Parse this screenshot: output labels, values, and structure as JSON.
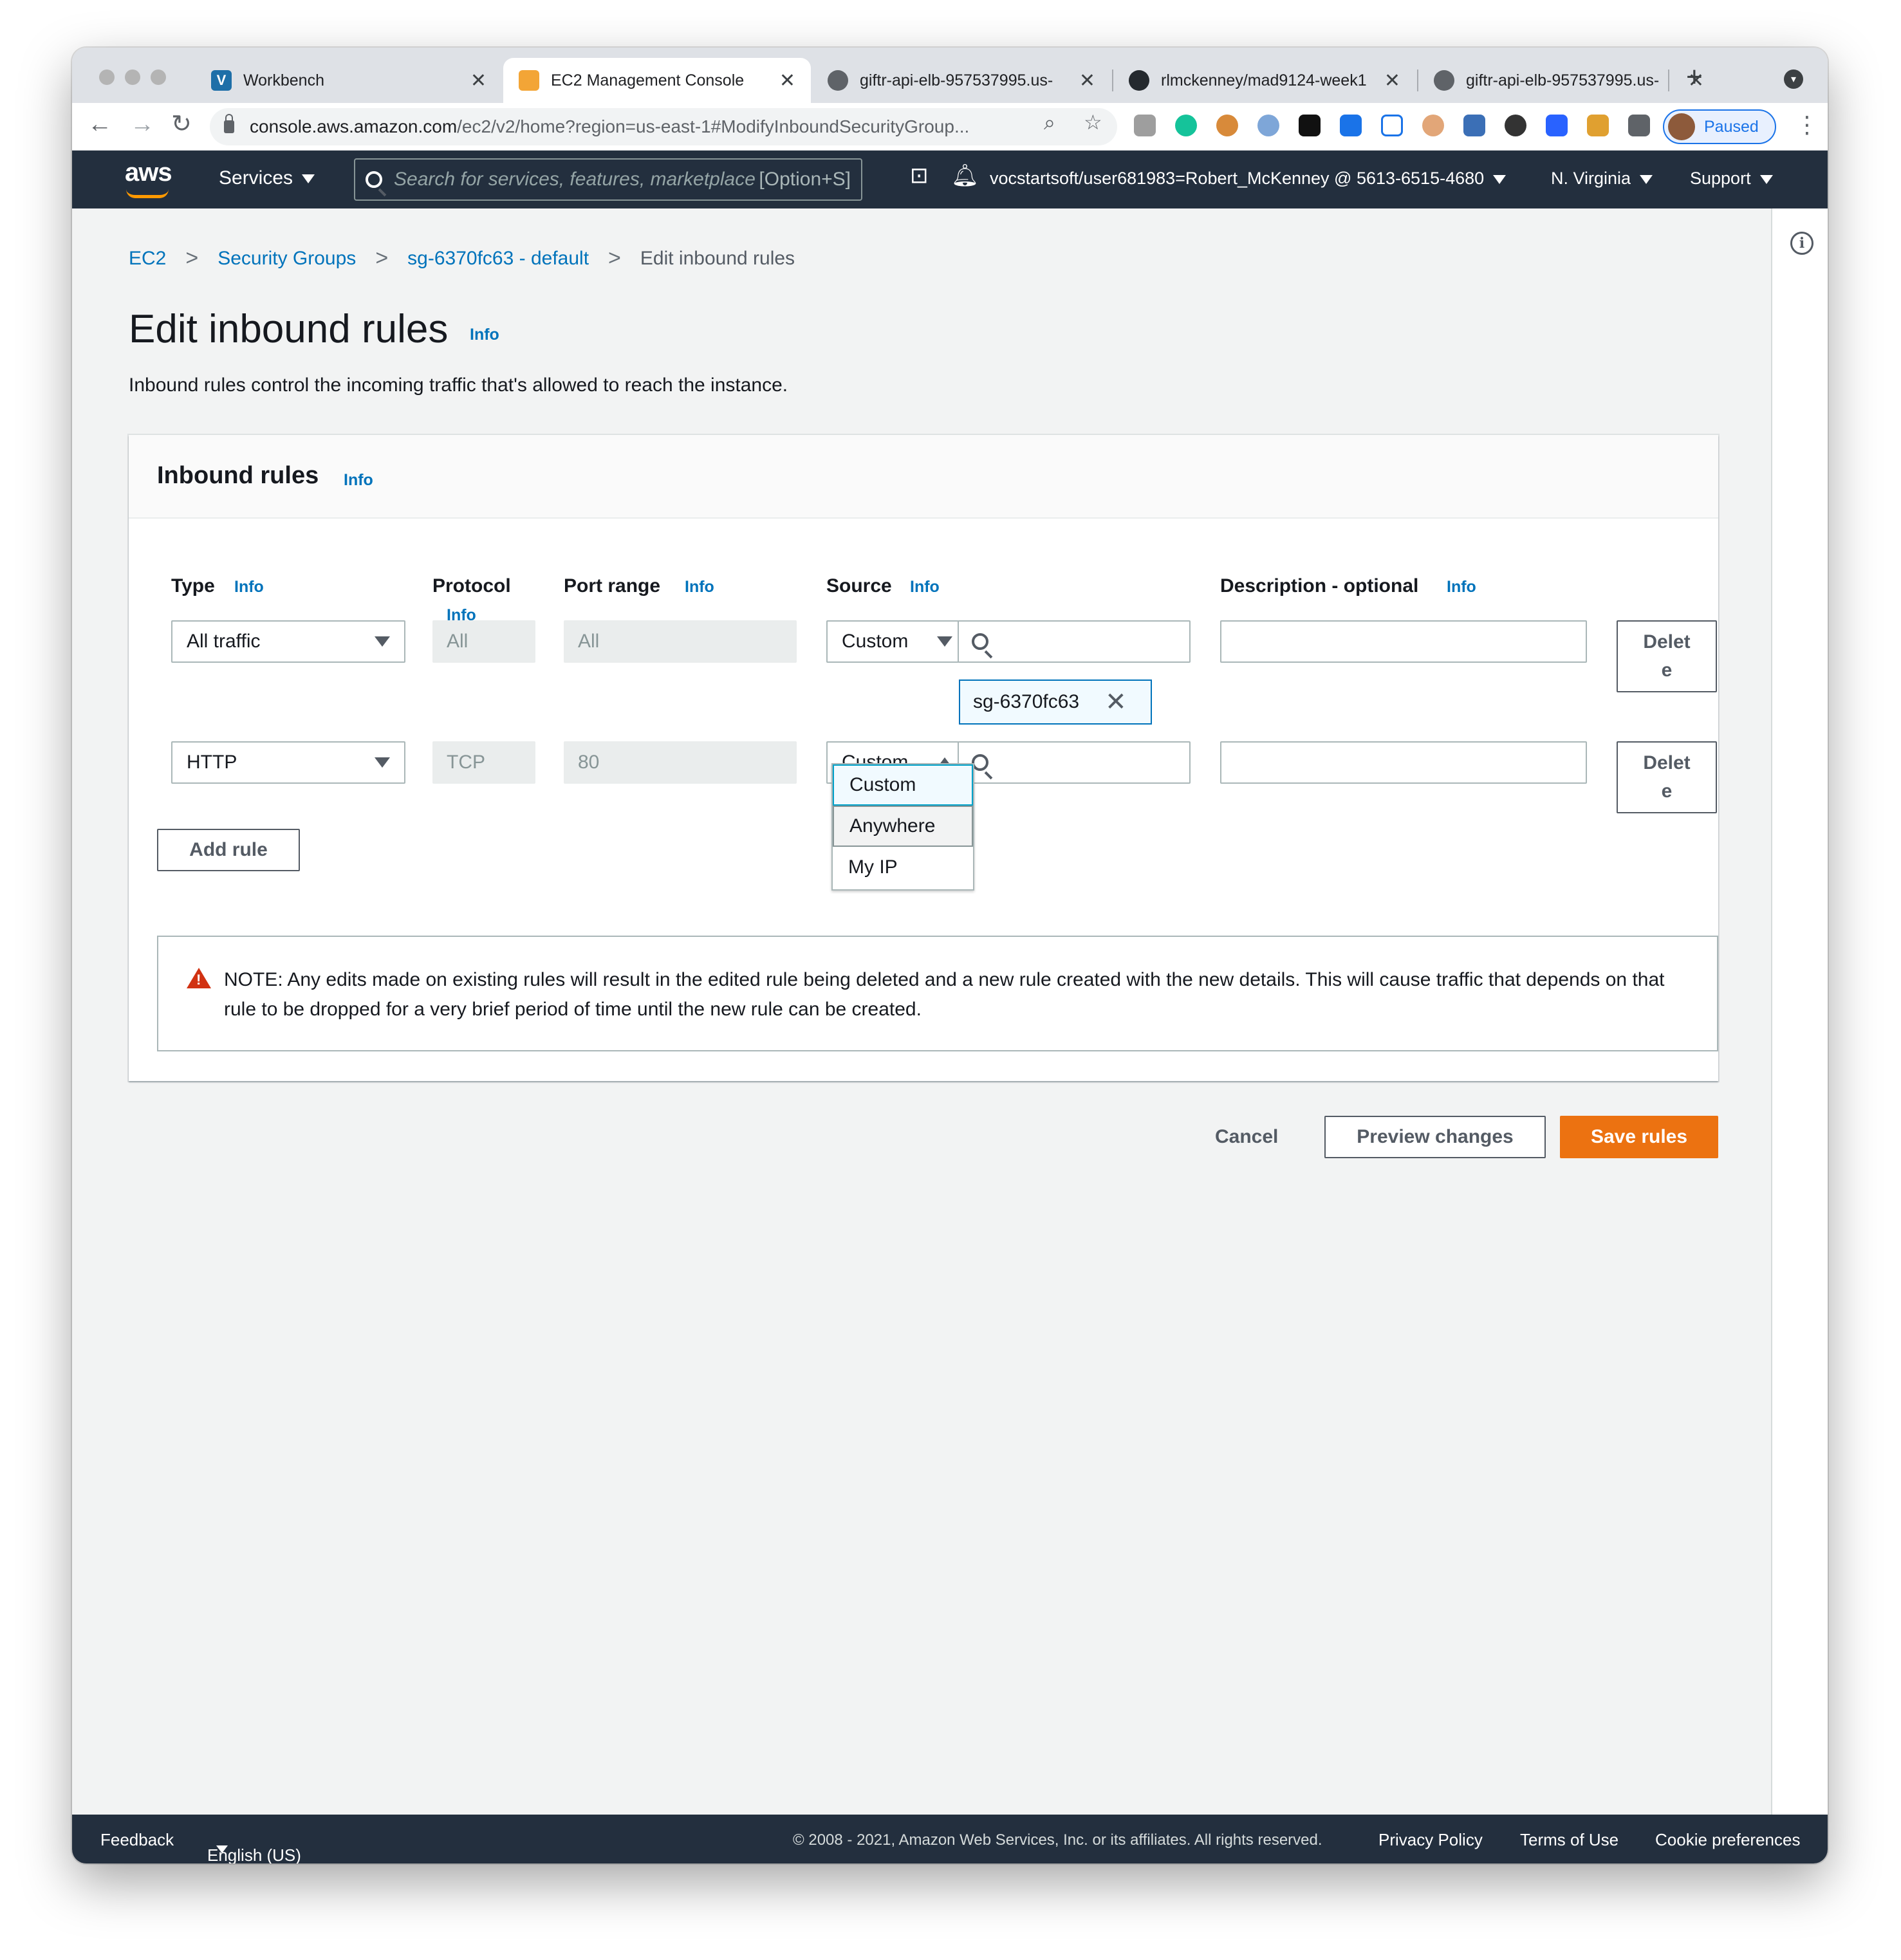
{
  "browser": {
    "tabs": [
      {
        "title": "Workbench",
        "favicon_letter": "V",
        "favicon_color": "#1e6fa8"
      },
      {
        "title": "EC2 Management Console",
        "favicon_color": "#f3a536"
      },
      {
        "title": "giftr-api-elb-957537995.us-",
        "favicon_color": "#5f6368"
      },
      {
        "title": "rlmckenney/mad9124-week1",
        "favicon_color": "#24292e"
      },
      {
        "title": "giftr-api-elb-957537995.us-",
        "favicon_color": "#5f6368"
      }
    ],
    "active_tab_index": 1,
    "url_host": "console.aws.amazon.com",
    "url_path": "/ec2/v2/home?region=us-east-1#ModifyInboundSecurityGroup...",
    "profile_status": "Paused"
  },
  "awsnav": {
    "logo": "aws",
    "services": "Services",
    "search_placeholder": "Search for services, features, marketplace products, and docs",
    "search_shortcut": "[Option+S]",
    "account": "vocstartsoft/user681983=Robert_McKenney @ 5613-6515-4680",
    "region": "N. Virginia",
    "support": "Support"
  },
  "breadcrumb": {
    "items": [
      "EC2",
      "Security Groups",
      "sg-6370fc63 - default"
    ],
    "current": "Edit inbound rules"
  },
  "page": {
    "title": "Edit inbound rules",
    "info": "Info",
    "description": "Inbound rules control the incoming traffic that's allowed to reach the instance."
  },
  "panel": {
    "title": "Inbound rules",
    "columns": {
      "type": "Type",
      "protocol": "Protocol",
      "port_range": "Port range",
      "source": "Source",
      "description": "Description - optional"
    },
    "rules": [
      {
        "type": "All traffic",
        "protocol": "All",
        "port_range": "All",
        "source_type": "Custom",
        "source_token": "sg-6370fc63",
        "description": "",
        "delete_label": "Delete"
      },
      {
        "type": "HTTP",
        "protocol": "TCP",
        "port_range": "80",
        "source_type": "Custom",
        "description": "",
        "delete_label": "Delete"
      }
    ],
    "source_options": [
      "Custom",
      "Anywhere",
      "My IP"
    ],
    "add_rule": "Add rule",
    "note": "NOTE: Any edits made on existing rules will result in the edited rule being deleted and a new rule created with the new details. This will cause traffic that depends on that rule to be dropped for a very brief period of time until the new rule can be created."
  },
  "actions": {
    "cancel": "Cancel",
    "preview": "Preview changes",
    "save": "Save rules"
  },
  "footer": {
    "feedback": "Feedback",
    "language": "English (US)",
    "copyright": "© 2008 - 2021, Amazon Web Services, Inc. or its affiliates. All rights reserved.",
    "privacy": "Privacy Policy",
    "terms": "Terms of Use",
    "cookies": "Cookie preferences"
  },
  "colors": {
    "aws_nav": "#232f3e",
    "link": "#0073bb",
    "primary_button": "#ec7211",
    "warning": "#d13212"
  }
}
